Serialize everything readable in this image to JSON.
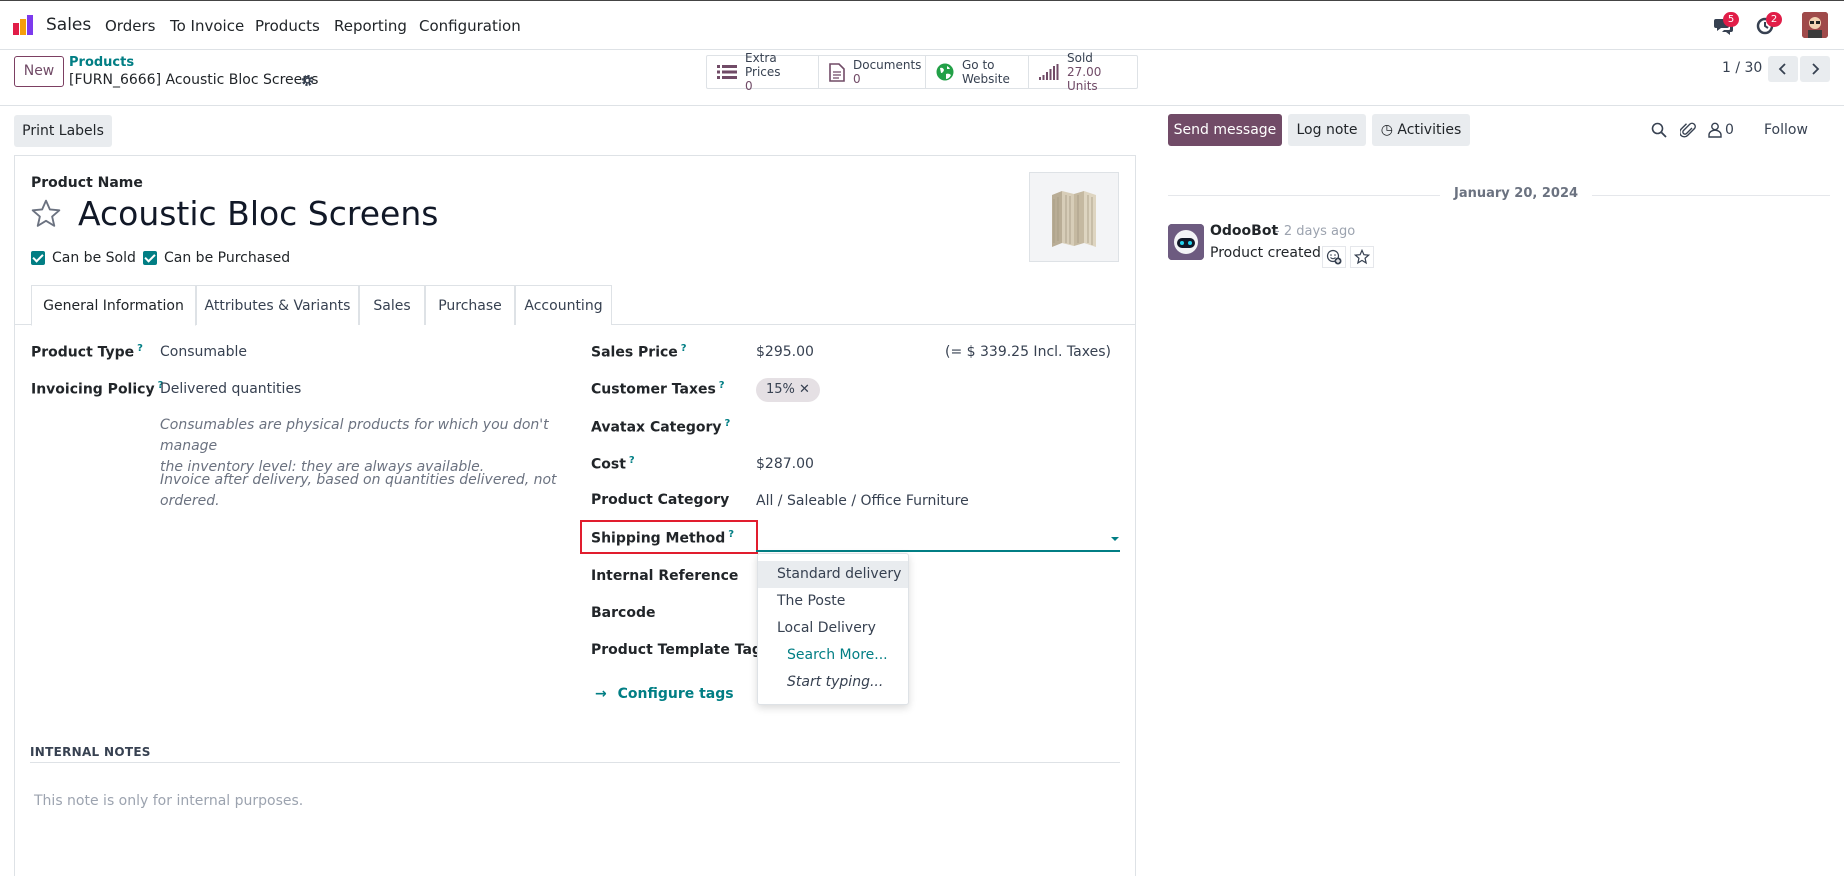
{
  "nav": {
    "app": "Sales",
    "menu": [
      "Orders",
      "To Invoice",
      "Products",
      "Reporting",
      "Configuration"
    ],
    "messages_count": "5",
    "activities_count": "2"
  },
  "control": {
    "new_label": "New",
    "breadcrumb_parent": "Products",
    "breadcrumb_current": "[FURN_6666] Acoustic Bloc Screens",
    "smart": {
      "extra_prices": {
        "label": "Extra Prices",
        "value": "0"
      },
      "documents": {
        "label": "Documents",
        "value": "0"
      },
      "website": {
        "label1": "Go to",
        "label2": "Website"
      },
      "sold": {
        "label": "Sold",
        "value": "27.00 Units"
      }
    },
    "pager": "1 / 30"
  },
  "form": {
    "print_labels": "Print Labels",
    "product_name_label": "Product Name",
    "product_name": "Acoustic Bloc Screens",
    "can_be_sold": "Can be Sold",
    "can_be_purchased": "Can be Purchased",
    "tabs": [
      "General Information",
      "Attributes & Variants",
      "Sales",
      "Purchase",
      "Accounting"
    ],
    "left": {
      "product_type_label": "Product Type",
      "product_type": "Consumable",
      "invoicing_policy_label": "Invoicing Policy",
      "invoicing_policy": "Delivered quantities",
      "help1_line1": "Consumables are physical products for which you don't manage",
      "help1_line2": "the inventory level: they are always available.",
      "help2": "Invoice after delivery, based on quantities delivered, not ordered."
    },
    "right": {
      "sales_price_label": "Sales Price",
      "sales_price": "$295.00",
      "incl_taxes": "(= $ 339.25 Incl. Taxes)",
      "customer_taxes_label": "Customer Taxes",
      "customer_tax_tag": "15%",
      "avatax_label": "Avatax Category",
      "cost_label": "Cost",
      "cost": "$287.00",
      "category_label": "Product Category",
      "category": "All / Saleable / Office Furniture",
      "shipping_label": "Shipping Method",
      "internal_ref_label": "Internal Reference",
      "barcode_label": "Barcode",
      "template_tags_label": "Product Template Tags",
      "configure_tags": "Configure tags"
    },
    "dropdown": [
      "Standard delivery",
      "The Poste",
      "Local Delivery"
    ],
    "dropdown_search_more": "Search More...",
    "dropdown_start_typing": "Start typing...",
    "internal_notes_heading": "INTERNAL NOTES",
    "internal_notes_placeholder": "This note is only for internal purposes."
  },
  "chatter": {
    "send_message": "Send message",
    "log_note": "Log note",
    "activities": "Activities",
    "followers_count": "0",
    "follow": "Follow",
    "date": "January 20, 2024",
    "author": "OdooBot",
    "time": "- 2 days ago",
    "body": "Product created"
  },
  "colors": {
    "brand": "#714b67",
    "accent": "#017e84",
    "highlight": "#e11d2e"
  }
}
